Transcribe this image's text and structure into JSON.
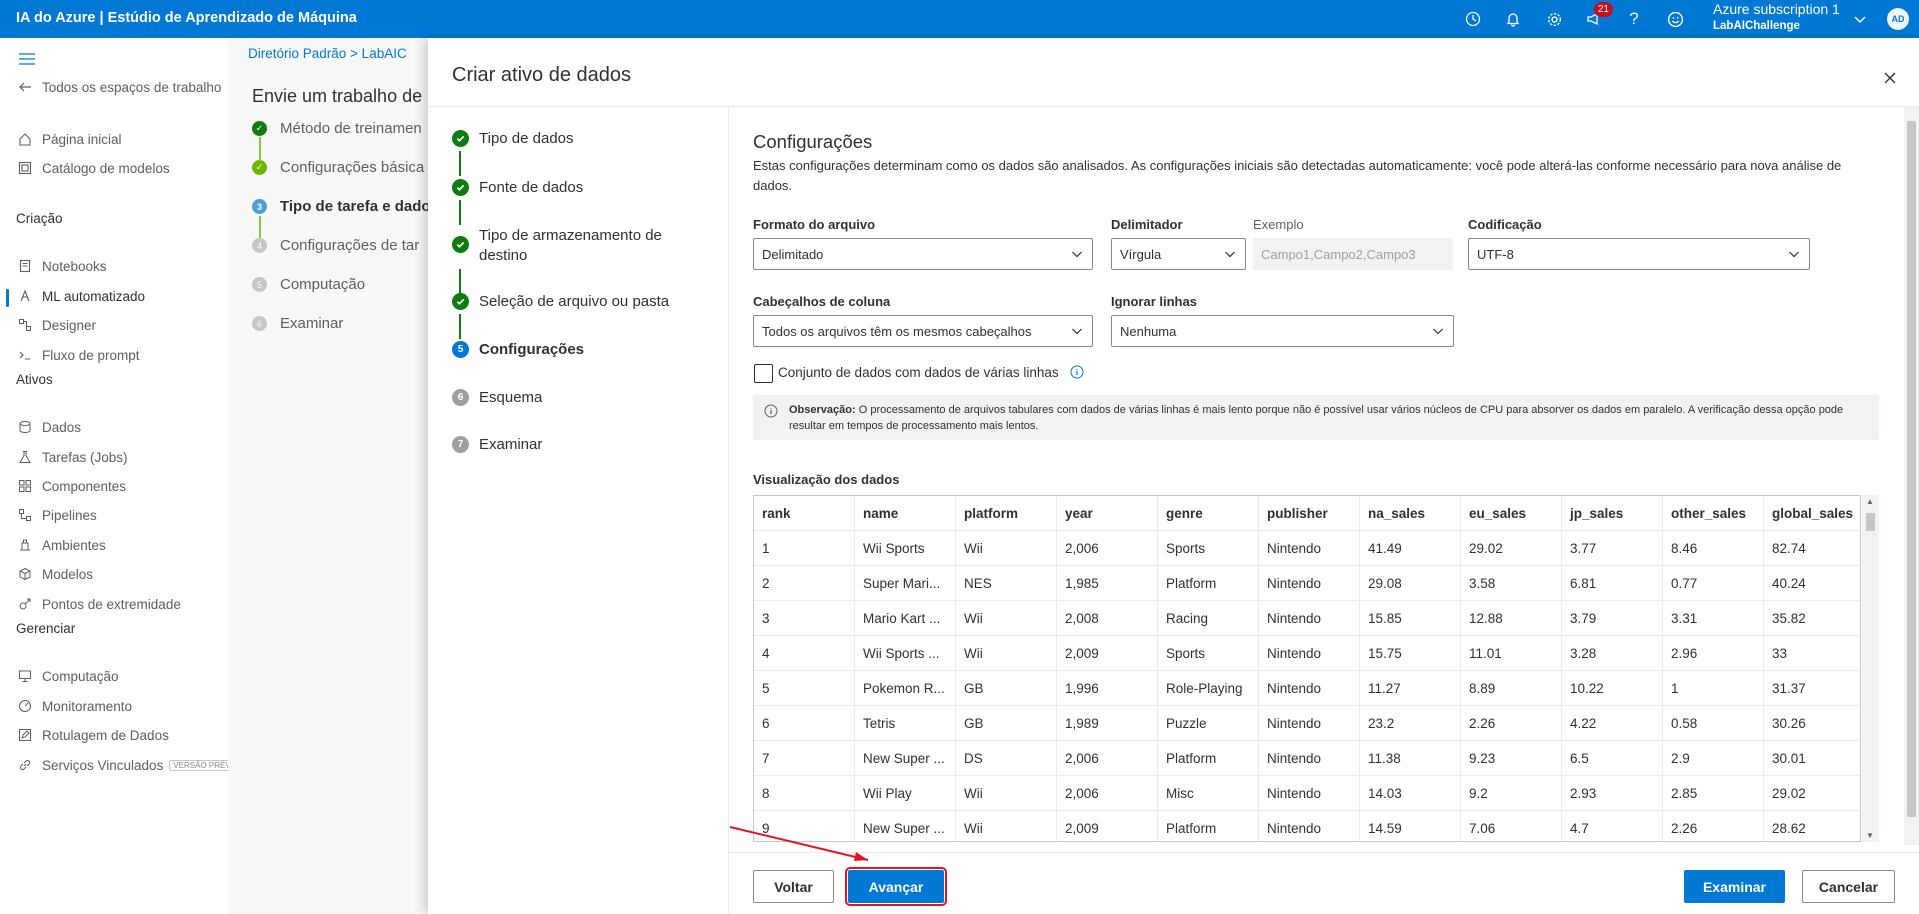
{
  "topbar": {
    "title": "IA do Azure | Estúdio de Aprendizado de Máquina",
    "notification_count": "21",
    "account_name": "Azure subscription 1",
    "workspace": "LabAIChallenge",
    "avatar_initials": "AD"
  },
  "sidebar": {
    "back_label": "Todos os espaços de trabalho",
    "top_items": [
      "Página inicial",
      "Catálogo de modelos"
    ],
    "sections": [
      {
        "title": "Criação",
        "items": [
          "Notebooks",
          "ML automatizado",
          "Designer",
          "Fluxo de prompt"
        ]
      },
      {
        "title": "Ativos",
        "items": [
          "Dados",
          "Tarefas (Jobs)",
          "Componentes",
          "Pipelines",
          "Ambientes",
          "Modelos",
          "Pontos de extremidade"
        ]
      },
      {
        "title": "Gerenciar",
        "items": [
          "Computação",
          "Monitoramento",
          "Rotulagem de Dados",
          "Serviços Vinculados"
        ]
      }
    ],
    "preview_tag": "VERSÃO PRÉVIA"
  },
  "background": {
    "breadcrumb": "Diretório Padrão  >  LabAIC",
    "title": "Envie um trabalho de",
    "steps": [
      {
        "num": "1",
        "label": "Método de treinamen",
        "status": "done"
      },
      {
        "num": "2",
        "label": "Configurações básica",
        "status": "done"
      },
      {
        "num": "3",
        "label": "Tipo de tarefa e dado",
        "status": "current"
      },
      {
        "num": "4",
        "label": "Configurações de tar",
        "status": "pending"
      },
      {
        "num": "5",
        "label": "Computação",
        "status": "pending"
      },
      {
        "num": "6",
        "label": "Examinar",
        "status": "pending"
      }
    ]
  },
  "panel": {
    "title": "Criar ativo de dados",
    "wizard": [
      {
        "num": "1",
        "label": "Tipo de dados",
        "status": "done"
      },
      {
        "num": "2",
        "label": "Fonte de dados",
        "status": "done"
      },
      {
        "num": "3",
        "label": "Tipo de armazenamento de destino",
        "status": "done"
      },
      {
        "num": "4",
        "label": "Seleção de arquivo ou pasta",
        "status": "done"
      },
      {
        "num": "5",
        "label": "Configurações",
        "status": "current"
      },
      {
        "num": "6",
        "label": "Esquema",
        "status": "pending"
      },
      {
        "num": "7",
        "label": "Examinar",
        "status": "pending"
      }
    ],
    "section_title": "Configurações",
    "section_desc": "Estas configurações determinam como os dados são analisados. As configurações iniciais são detectadas automaticamente: você pode alterá-las conforme necessário para nova análise de dados.",
    "file_format": {
      "label": "Formato do arquivo",
      "value": "Delimitado"
    },
    "delimiter": {
      "label": "Delimitador",
      "value": "Vírgula"
    },
    "example": {
      "label": "Exemplo",
      "value": "Campo1,Campo2,Campo3"
    },
    "encoding": {
      "label": "Codificação",
      "value": "UTF-8"
    },
    "column_headers": {
      "label": "Cabeçalhos de coluna",
      "value": "Todos os arquivos têm os mesmos cabeçalhos"
    },
    "skip_rows": {
      "label": "Ignorar linhas",
      "value": "Nenhuma"
    },
    "multiline_checkbox": "Conjunto de dados com dados de várias linhas",
    "note_bold": "Observação:",
    "note_text": " O processamento de arquivos tabulares com dados de várias linhas é mais lento porque não é possível usar vários núcleos de CPU para absorver os dados em paralelo. A verificação dessa opção pode resultar em tempos de processamento mais lentos.",
    "preview_title": "Visualização dos dados",
    "table": {
      "columns": [
        "rank",
        "name",
        "platform",
        "year",
        "genre",
        "publisher",
        "na_sales",
        "eu_sales",
        "jp_sales",
        "other_sales",
        "global_sales"
      ],
      "rows": [
        [
          "1",
          "Wii Sports",
          "Wii",
          "2,006",
          "Sports",
          "Nintendo",
          "41.49",
          "29.02",
          "3.77",
          "8.46",
          "82.74"
        ],
        [
          "2",
          "Super Mari...",
          "NES",
          "1,985",
          "Platform",
          "Nintendo",
          "29.08",
          "3.58",
          "6.81",
          "0.77",
          "40.24"
        ],
        [
          "3",
          "Mario Kart ...",
          "Wii",
          "2,008",
          "Racing",
          "Nintendo",
          "15.85",
          "12.88",
          "3.79",
          "3.31",
          "35.82"
        ],
        [
          "4",
          "Wii Sports ...",
          "Wii",
          "2,009",
          "Sports",
          "Nintendo",
          "15.75",
          "11.01",
          "3.28",
          "2.96",
          "33"
        ],
        [
          "5",
          "Pokemon R...",
          "GB",
          "1,996",
          "Role-Playing",
          "Nintendo",
          "11.27",
          "8.89",
          "10.22",
          "1",
          "31.37"
        ],
        [
          "6",
          "Tetris",
          "GB",
          "1,989",
          "Puzzle",
          "Nintendo",
          "23.2",
          "2.26",
          "4.22",
          "0.58",
          "30.26"
        ],
        [
          "7",
          "New Super ...",
          "DS",
          "2,006",
          "Platform",
          "Nintendo",
          "11.38",
          "9.23",
          "6.5",
          "2.9",
          "30.01"
        ],
        [
          "8",
          "Wii Play",
          "Wii",
          "2,006",
          "Misc",
          "Nintendo",
          "14.03",
          "9.2",
          "2.93",
          "2.85",
          "29.02"
        ],
        [
          "9",
          "New Super ...",
          "Wii",
          "2,009",
          "Platform",
          "Nintendo",
          "14.59",
          "7.06",
          "4.7",
          "2.26",
          "28.62"
        ]
      ]
    },
    "buttons": {
      "back": "Voltar",
      "next": "Avançar",
      "review": "Examinar",
      "cancel": "Cancelar"
    }
  },
  "colors": {
    "brand": "#0078d4",
    "success": "#107c10",
    "highlight": "#e81123"
  }
}
